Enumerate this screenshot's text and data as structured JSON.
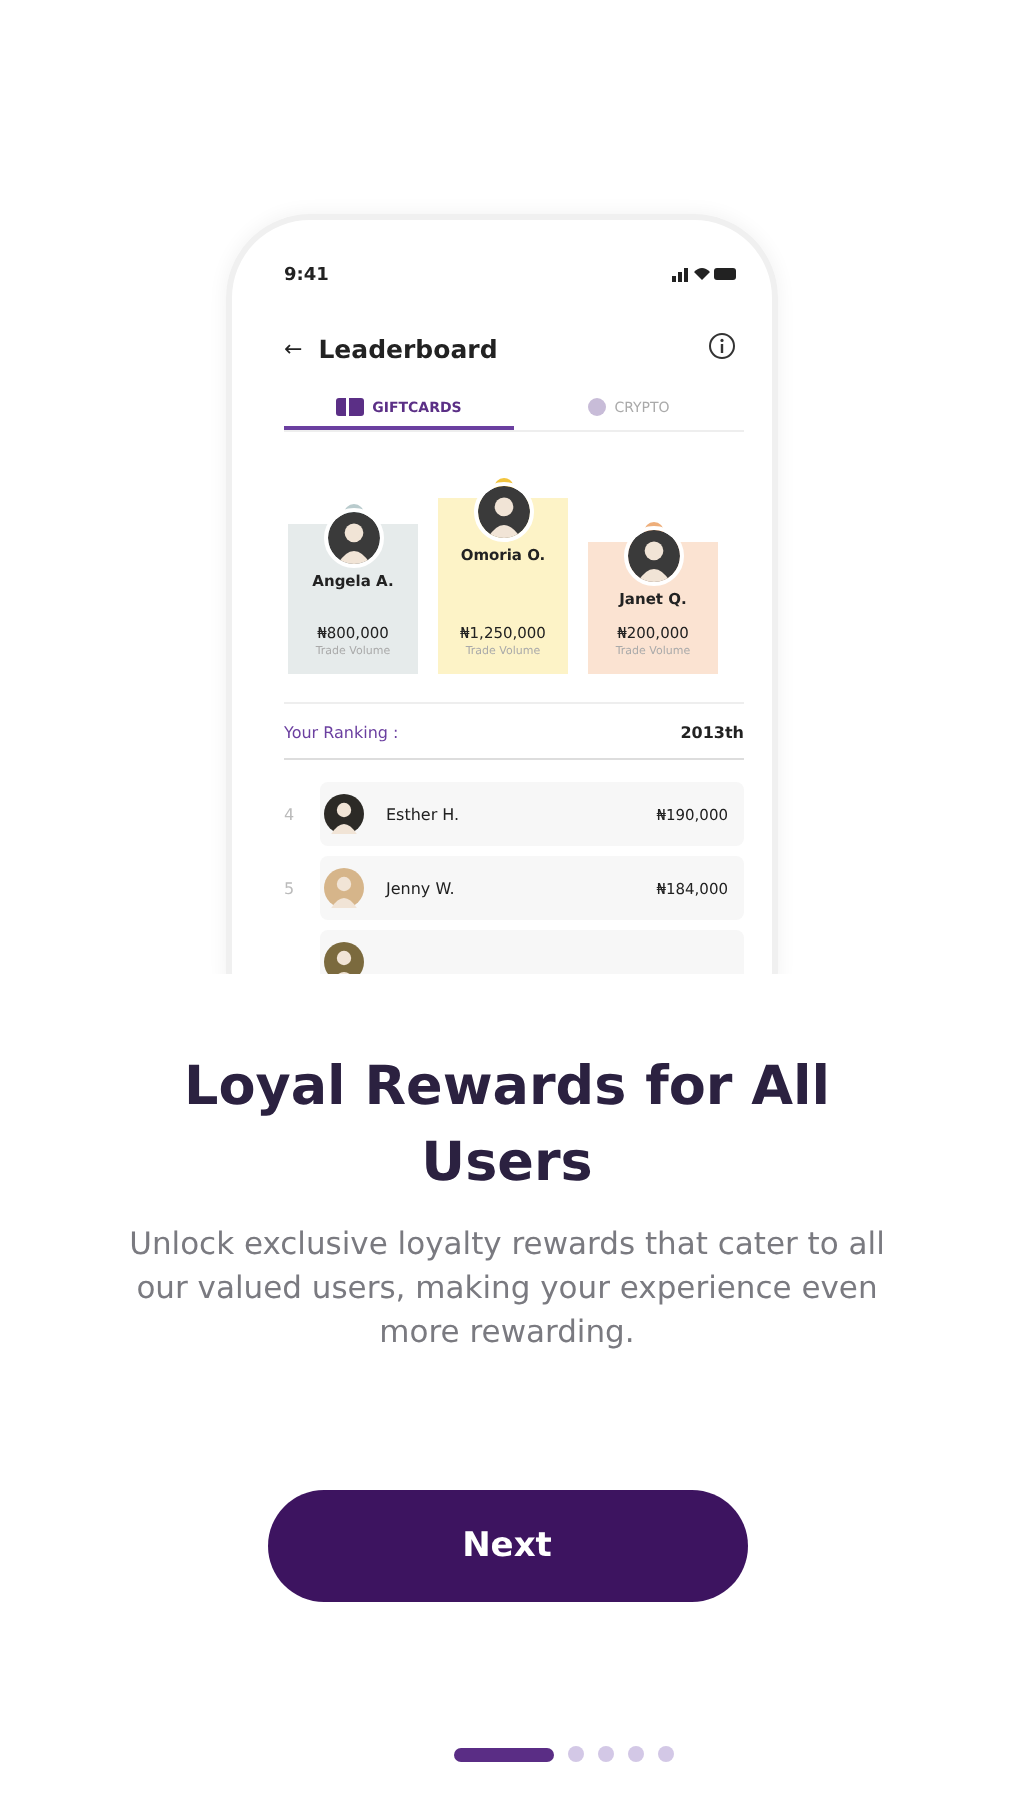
{
  "phone": {
    "status_bar": {
      "time": "9:41"
    },
    "header": {
      "back": "←",
      "title": "Leaderboard"
    },
    "tabs": [
      {
        "label": "GIFTCARDS",
        "kind": "giftcard",
        "selected": true
      },
      {
        "label": "CRYPTO",
        "kind": "crypto",
        "selected": false
      }
    ],
    "podium": [
      {
        "name": "Angela A.",
        "amount": "₦800,000",
        "caption": "Trade Volume",
        "color": "#e6ebeb",
        "kind": "second"
      },
      {
        "name": "Omoria O.",
        "amount": "₦1,250,000",
        "caption": "Trade Volume",
        "color": "#fdf3c7",
        "kind": "first"
      },
      {
        "name": "Janet Q.",
        "amount": "₦200,000",
        "caption": "Trade Volume",
        "color": "#fbe3d2",
        "kind": "third"
      }
    ],
    "ranking": {
      "label": "Your Ranking :",
      "value": "2013th"
    },
    "rows": [
      {
        "kind": "row",
        "rank": "4",
        "name": "Esther H.",
        "amount": "₦190,000"
      },
      {
        "kind": "row",
        "rank": "5",
        "name": "Jenny W.",
        "amount": "₦184,000"
      },
      {
        "kind": "partial"
      }
    ]
  },
  "title": "Loyal Rewards for All Users",
  "description": "Unlock exclusive loyalty rewards that cater to all our valued users, making your experience even more rewarding.",
  "button": "Next",
  "pager": [
    {
      "selected": true
    },
    {
      "selected": false
    },
    {
      "selected": false
    },
    {
      "selected": false
    },
    {
      "selected": false
    }
  ]
}
